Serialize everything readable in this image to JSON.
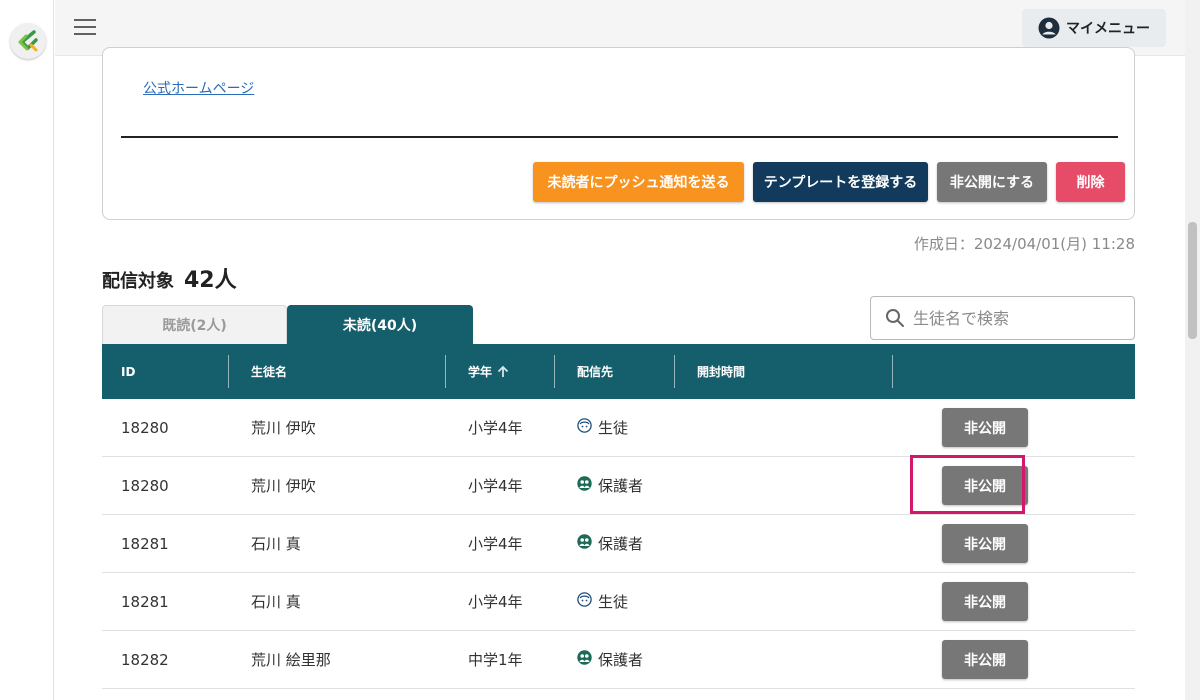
{
  "header": {
    "my_menu_label": "マイメニュー"
  },
  "message": {
    "homepage_link": "公式ホームページ",
    "actions": {
      "push_unread": "未読者にプッシュ通知を送る",
      "register_template": "テンプレートを登録する",
      "make_private": "非公開にする",
      "delete": "削除"
    },
    "created_at": "作成日：2024/04/01(月) 11:28"
  },
  "recipients": {
    "label": "配信対象",
    "count": "42人",
    "tabs": {
      "read": "既読(2人)",
      "unread": "未読(40人)"
    },
    "search_placeholder": "生徒名で検索",
    "columns": {
      "id": "ID",
      "name": "生徒名",
      "grade": "学年",
      "destination": "配信先",
      "opened_at": "開封時間"
    },
    "hide_button_label": "非公開",
    "rows": [
      {
        "id": "18280",
        "name": "荒川 伊吹",
        "grade": "小学4年",
        "destination": "生徒",
        "dest_icon": "student-icon",
        "opened_at": ""
      },
      {
        "id": "18280",
        "name": "荒川 伊吹",
        "grade": "小学4年",
        "destination": "保護者",
        "dest_icon": "guardian-icon",
        "opened_at": ""
      },
      {
        "id": "18281",
        "name": "石川 真",
        "grade": "小学4年",
        "destination": "保護者",
        "dest_icon": "guardian-icon",
        "opened_at": ""
      },
      {
        "id": "18281",
        "name": "石川 真",
        "grade": "小学4年",
        "destination": "生徒",
        "dest_icon": "student-icon",
        "opened_at": ""
      },
      {
        "id": "18282",
        "name": "荒川 絵里那",
        "grade": "中学1年",
        "destination": "保護者",
        "dest_icon": "guardian-icon",
        "opened_at": ""
      }
    ]
  },
  "colors": {
    "teal": "#155f6c",
    "orange": "#f7931e",
    "navy": "#123a5c",
    "grey_button": "#777777",
    "red": "#e64c68",
    "highlight": "#d1186b"
  }
}
